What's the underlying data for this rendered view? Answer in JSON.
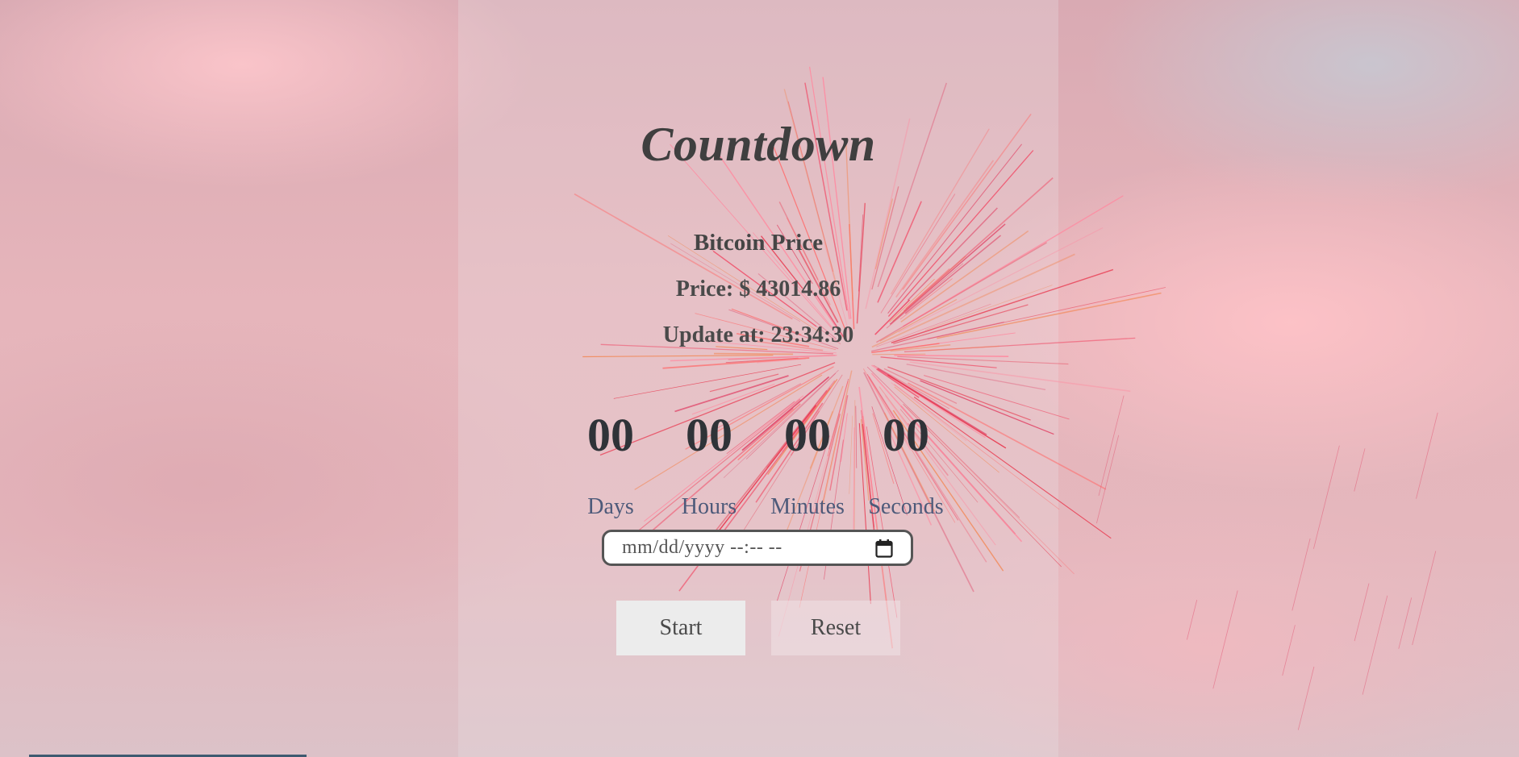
{
  "page": {
    "title": "Countdown"
  },
  "bitcoin": {
    "heading": "Bitcoin Price",
    "price_line": "Price: $ 43014.86",
    "update_line": "Update at: 23:34:30"
  },
  "timer": {
    "days_value": "00",
    "hours_value": "00",
    "minutes_value": "00",
    "seconds_value": "00",
    "days_label": "Days",
    "hours_label": "Hours",
    "minutes_label": "Minutes",
    "seconds_label": "Seconds"
  },
  "datetime_input": {
    "placeholder": "mm/dd/yyyy --:-- --",
    "icon": "calendar-icon"
  },
  "buttons": {
    "start_label": "Start",
    "reset_label": "Reset"
  },
  "colors": {
    "title": "#3f3f3f",
    "timer_digits": "#2f3338",
    "timer_labels": "#4d5a7a",
    "firework": "#e8334a"
  }
}
